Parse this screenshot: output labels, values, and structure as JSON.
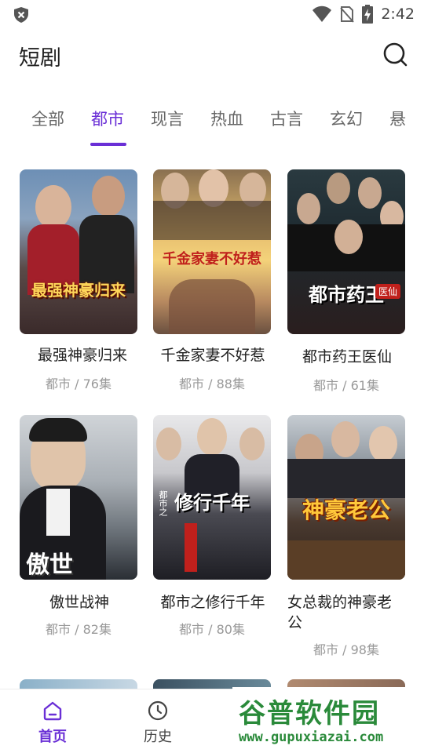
{
  "status_bar": {
    "time": "2:42"
  },
  "header": {
    "title": "短剧"
  },
  "tabs": [
    {
      "label": "全部",
      "active": false
    },
    {
      "label": "都市",
      "active": true
    },
    {
      "label": "现言",
      "active": false
    },
    {
      "label": "热血",
      "active": false
    },
    {
      "label": "古言",
      "active": false
    },
    {
      "label": "玄幻",
      "active": false
    },
    {
      "label": "悬",
      "active": false
    }
  ],
  "dramas": [
    {
      "title": "最强神豪归来",
      "meta": "都市 / 76集",
      "poster_text": "最强神豪归来"
    },
    {
      "title": "千金家妻不好惹",
      "meta": "都市 / 88集",
      "poster_text": "千金家妻不好惹"
    },
    {
      "title": "都市药王医仙",
      "meta": "都市 / 61集",
      "poster_text": "都市药王",
      "poster_badge": "医仙"
    },
    {
      "title": "傲世战神",
      "meta": "都市 / 82集",
      "poster_text": "傲世"
    },
    {
      "title": "都市之修行千年",
      "meta": "都市 / 80集",
      "poster_text": "修行千年",
      "poster_prefix": "都市之"
    },
    {
      "title": "女总裁的神豪老公",
      "meta": "都市 / 98集",
      "poster_text": "神豪老公"
    }
  ],
  "bottom_nav": [
    {
      "label": "首页",
      "active": true
    },
    {
      "label": "历史",
      "active": false
    }
  ],
  "watermark": {
    "main": "谷普软件园",
    "sub": "www.gupuxiazai.com"
  },
  "colors": {
    "accent": "#6a2fd6",
    "watermark": "#2a8a3a"
  }
}
